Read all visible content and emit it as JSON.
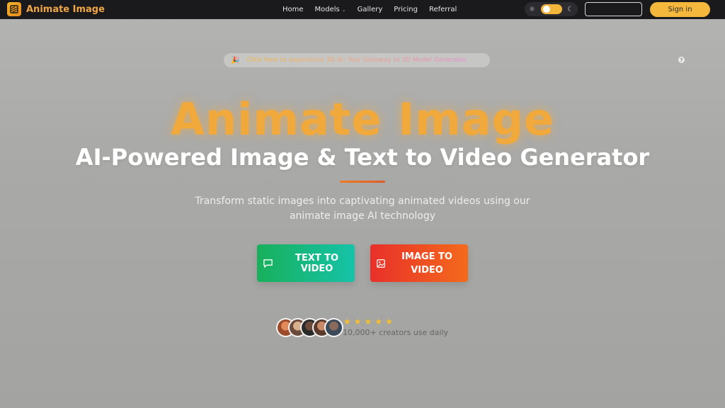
{
  "brand": {
    "name": "Animate Image"
  },
  "nav": {
    "links": [
      {
        "label": "Home"
      },
      {
        "label": "Models"
      },
      {
        "label": "Gallery"
      },
      {
        "label": "Pricing"
      },
      {
        "label": "Referral"
      }
    ],
    "signin_label": "Sign in"
  },
  "announcement": {
    "text": "Click here to experience 3D AI: Your Gateway to 3D Model Generator."
  },
  "hero": {
    "brand_title": "Animate Image",
    "title": "AI-Powered Image & Text to Video Generator",
    "subtitle": "Transform static images into captivating animated videos using our animate image AI technology"
  },
  "cta": {
    "text_to_video": "TEXT TO VIDEO",
    "image_to_video": "IMAGE TO VIDEO"
  },
  "social_proof": {
    "rating_stars": 5,
    "creators_text": "10,000+ creators use daily"
  },
  "colors": {
    "accent": "#f5b73c",
    "brand_text": "#f0a646",
    "green_cta": "#18b05c",
    "red_cta": "#e8302a"
  }
}
